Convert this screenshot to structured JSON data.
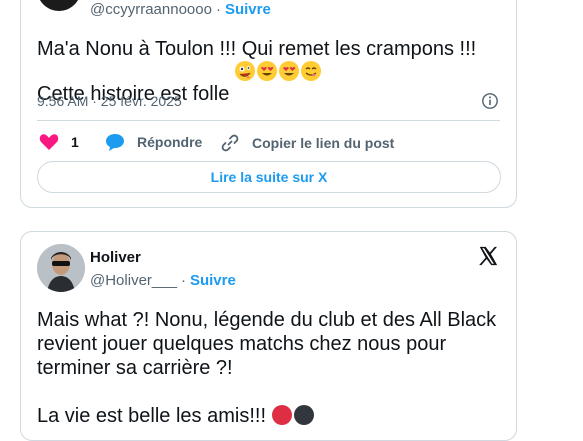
{
  "colors": {
    "accent": "#1d9bf0",
    "heart": "#f91880",
    "muted": "#536471",
    "text": "#0f1419",
    "border": "#cfd9de"
  },
  "tweet1": {
    "handle": "@ccyyrraannoooo",
    "separator": "·",
    "follow_label": "Suivre",
    "text": "Ma'a Nonu à Toulon !!! Qui remet les crampons !!!\nCette histoire est folle ",
    "emojis": [
      "zany-face",
      "heart-eyes",
      "heart-eyes",
      "yum-face"
    ],
    "timestamp": "9:56 AM · 25 févr. 2025",
    "like_count": "1",
    "reply_label": "Répondre",
    "copy_label": "Copier le lien du post",
    "read_more_label": "Lire la suite sur X"
  },
  "tweet2": {
    "author_name": "Holiver",
    "handle": "@Holiver___",
    "separator": "·",
    "follow_label": "Suivre",
    "text": "Mais what ?! Nonu, légende du club et des All Black\nrevient jouer quelques matchs chez nous pour\nterminer sa carrière ?!\n\nLa vie est belle les amis!!! ",
    "emojis": [
      "red-circle",
      "black-circle"
    ]
  }
}
